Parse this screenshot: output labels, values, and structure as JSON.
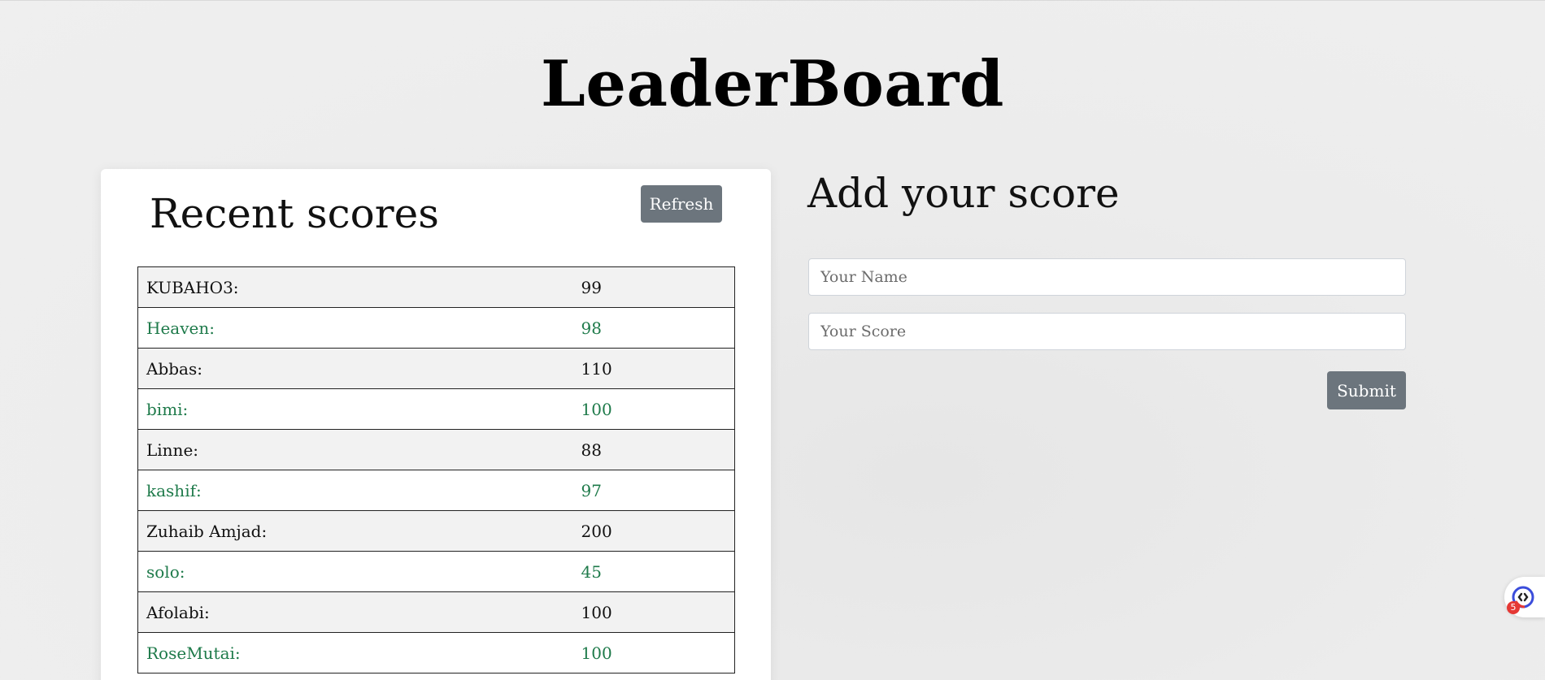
{
  "header": {
    "title": "LeaderBoard"
  },
  "recent_scores": {
    "heading": "Recent scores",
    "refresh_label": "Refresh",
    "rows": [
      {
        "name": "KUBAHO3:",
        "score": "99"
      },
      {
        "name": "Heaven:",
        "score": "98"
      },
      {
        "name": "Abbas:",
        "score": "110"
      },
      {
        "name": "bimi:",
        "score": "100"
      },
      {
        "name": "Linne:",
        "score": "88"
      },
      {
        "name": "kashif:",
        "score": "97"
      },
      {
        "name": "Zuhaib Amjad:",
        "score": "200"
      },
      {
        "name": "solo:",
        "score": "45"
      },
      {
        "name": "Afolabi:",
        "score": "100"
      },
      {
        "name": "RoseMutai:",
        "score": "100"
      }
    ]
  },
  "add_score": {
    "heading": "Add your score",
    "name_placeholder": "Your Name",
    "score_placeholder": "Your Score",
    "submit_label": "Submit"
  },
  "assistant_widget": {
    "icon": "chat-assistant-icon",
    "badge_count": "5"
  },
  "colors": {
    "button_bg": "#6c757d",
    "alt_row_text": "#1e7a4a",
    "striped_row_bg": "#f2f2f2"
  }
}
